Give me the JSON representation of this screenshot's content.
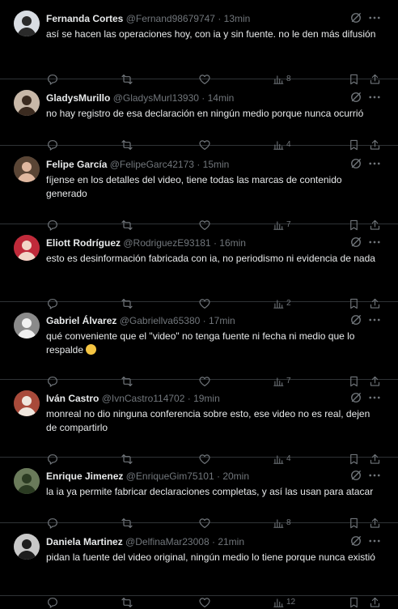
{
  "colors": {
    "background": "#000000",
    "text": "#e7e9ea",
    "muted": "#71767b",
    "divider": "#2f3336"
  },
  "tweets": [
    {
      "name": "Fernanda Cortes",
      "handle": "@Fernand98679747",
      "time": "13min",
      "text": "así se hacen las operaciones hoy, con ia y sin fuente. no le den más difusión",
      "views": "8"
    },
    {
      "name": "GladysMurillo",
      "handle": "@GladysMurl13930",
      "time": "14min",
      "text": "no hay registro de esa declaración en ningún medio porque nunca ocurrió",
      "views": "4"
    },
    {
      "name": "Felipe García",
      "handle": "@FelipeGarc42173",
      "time": "15min",
      "text": "fíjense en los detalles del video, tiene todas las marcas de contenido generado",
      "views": "7"
    },
    {
      "name": "Eliott Rodríguez",
      "handle": "@RodriguezE93181",
      "time": "16min",
      "text": "esto es desinformación fabricada con ia, no periodismo ni evidencia de nada",
      "views": "2"
    },
    {
      "name": "Gabriel Álvarez",
      "handle": "@Gabriellva65380",
      "time": "17min",
      "text": "qué conveniente que el \"video\" no tenga fuente ni fecha ni medio que lo respalde",
      "emoji": "thinking-face",
      "views": "7"
    },
    {
      "name": "Iván Castro",
      "handle": "@IvnCastro114702",
      "time": "19min",
      "text": "monreal no dio ninguna conferencia sobre esto, ese video no es real, dejen de compartirlo",
      "views": "4"
    },
    {
      "name": "Enrique Jimenez",
      "handle": "@EnriqueGim75101",
      "time": "20min",
      "text": "la ia ya permite fabricar declaraciones completas, y así las usan para atacar",
      "views": "8"
    },
    {
      "name": "Daniela Martinez",
      "handle": "@DelfinaMar23008",
      "time": "21min",
      "text": "pidan la fuente del video original, ningún medio lo tiene porque nunca existió",
      "views": "12"
    }
  ],
  "icons": {
    "grok": "grok-icon",
    "more": "more-icon",
    "reply": "reply-icon",
    "retweet": "retweet-icon",
    "like": "like-icon",
    "views": "views-icon",
    "bookmark": "bookmark-icon",
    "share": "share-icon"
  }
}
